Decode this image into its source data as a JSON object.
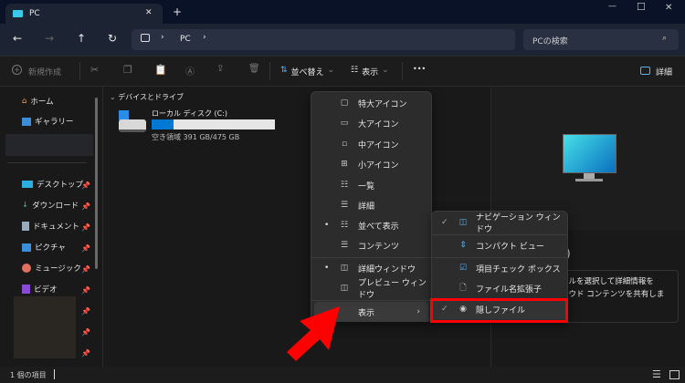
{
  "window": {
    "tab_title": "PC",
    "new_tab": "+",
    "minimize": "—",
    "maximize": "☐",
    "close": "✕"
  },
  "address": {
    "crumb": "PC",
    "search_placeholder": "PCの検索"
  },
  "toolbar": {
    "new": "新規作成",
    "sort": "並べ替え",
    "view": "表示",
    "more": "•••",
    "details": "詳細"
  },
  "sidebar": {
    "items": [
      {
        "label": "ホーム"
      },
      {
        "label": "ギャラリー"
      },
      {
        "label": "デスクトップ"
      },
      {
        "label": "ダウンロード"
      },
      {
        "label": "ドキュメント"
      },
      {
        "label": "ピクチャ"
      },
      {
        "label": "ミュージック"
      },
      {
        "label": "ビデオ"
      }
    ]
  },
  "content": {
    "group": "デバイスとドライブ",
    "drive_name": "ローカル ディスク (C:)",
    "drive_free": "空き領域 391 GB/475 GB",
    "drive_used_fraction": 0.18
  },
  "details_pane": {
    "title_fragment": ")",
    "line1": "イルを選択して詳細情報を",
    "line2": "ラウド コンテンツを共有しま"
  },
  "status": {
    "count": "1 個の項目"
  },
  "view_menu": {
    "items": [
      "特大アイコン",
      "大アイコン",
      "中アイコン",
      "小アイコン",
      "一覧",
      "詳細",
      "並べて表示",
      "コンテンツ",
      "詳細ウィンドウ",
      "プレビュー ウィンドウ"
    ],
    "show": "表示"
  },
  "show_submenu": {
    "items": [
      "ナビゲーション ウィンドウ",
      "コンパクト ビュー",
      "項目チェック ボックス",
      "ファイル名拡張子",
      "隠しファイル"
    ]
  },
  "colors": {
    "accent": "#0078d4",
    "highlight": "#ff0000"
  }
}
